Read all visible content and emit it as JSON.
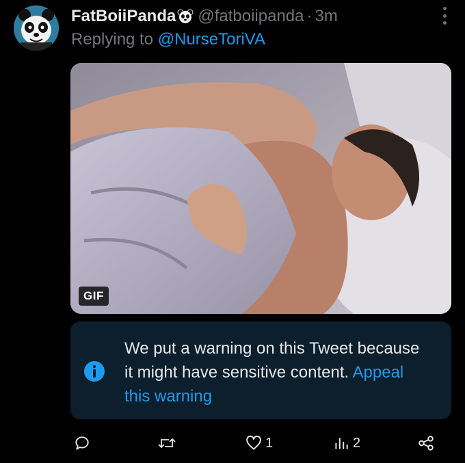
{
  "tweet": {
    "display_name": "FatBoiiPanda",
    "handle": "@fatboiipanda",
    "separator": "·",
    "time": "3m",
    "reply_prefix": "Replying to",
    "reply_to": "@NurseToriVA"
  },
  "media": {
    "badge": "GIF"
  },
  "warning": {
    "message": "We put a warning on this Tweet because it might have sensitive content.",
    "appeal_link": "Appeal this warning",
    "icon": "info-icon",
    "accent_color": "#1d9bf0",
    "background_color": "#0d1e2c"
  },
  "actions": {
    "reply": {
      "icon": "reply-icon",
      "count": ""
    },
    "retweet": {
      "icon": "retweet-icon",
      "count": ""
    },
    "like": {
      "icon": "heart-icon",
      "count": "1"
    },
    "views": {
      "icon": "analytics-icon",
      "count": "2"
    },
    "share": {
      "icon": "share-icon",
      "count": ""
    }
  },
  "colors": {
    "background": "#000000",
    "text": "#e7e9ea",
    "muted": "#71767b",
    "link": "#1d9bf0"
  }
}
